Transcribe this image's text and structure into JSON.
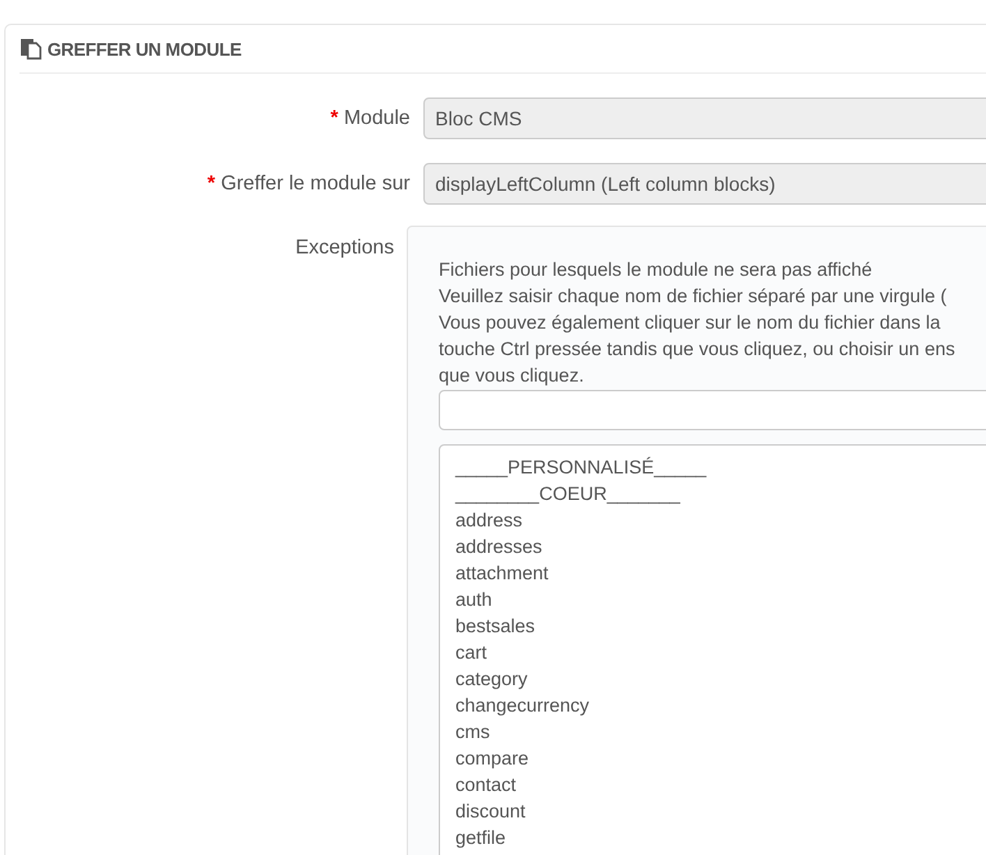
{
  "panel": {
    "title": "GREFFER UN MODULE"
  },
  "fields": [
    {
      "label": "Module",
      "required_mark": "*",
      "value": "Bloc CMS"
    },
    {
      "label": "Greffer le module sur",
      "required_mark": "*",
      "value": "displayLeftColumn (Left column blocks)"
    }
  ],
  "exceptions": {
    "label": "Exceptions",
    "description": [
      "Fichiers pour lesquels le module ne sera pas affiché",
      "Veuillez saisir chaque nom de fichier séparé par une virgule (",
      "Vous pouvez également cliquer sur le nom du fichier dans la",
      "touche Ctrl pressée tandis que vous cliquez, ou choisir un ens",
      "que vous cliquez."
    ],
    "files": [
      "_____PERSONNALISÉ_____",
      "________COEUR_______",
      "address",
      "addresses",
      "attachment",
      "auth",
      "bestsales",
      "cart",
      "category",
      "changecurrency",
      "cms",
      "compare",
      "contact",
      "discount",
      "getfile"
    ]
  }
}
